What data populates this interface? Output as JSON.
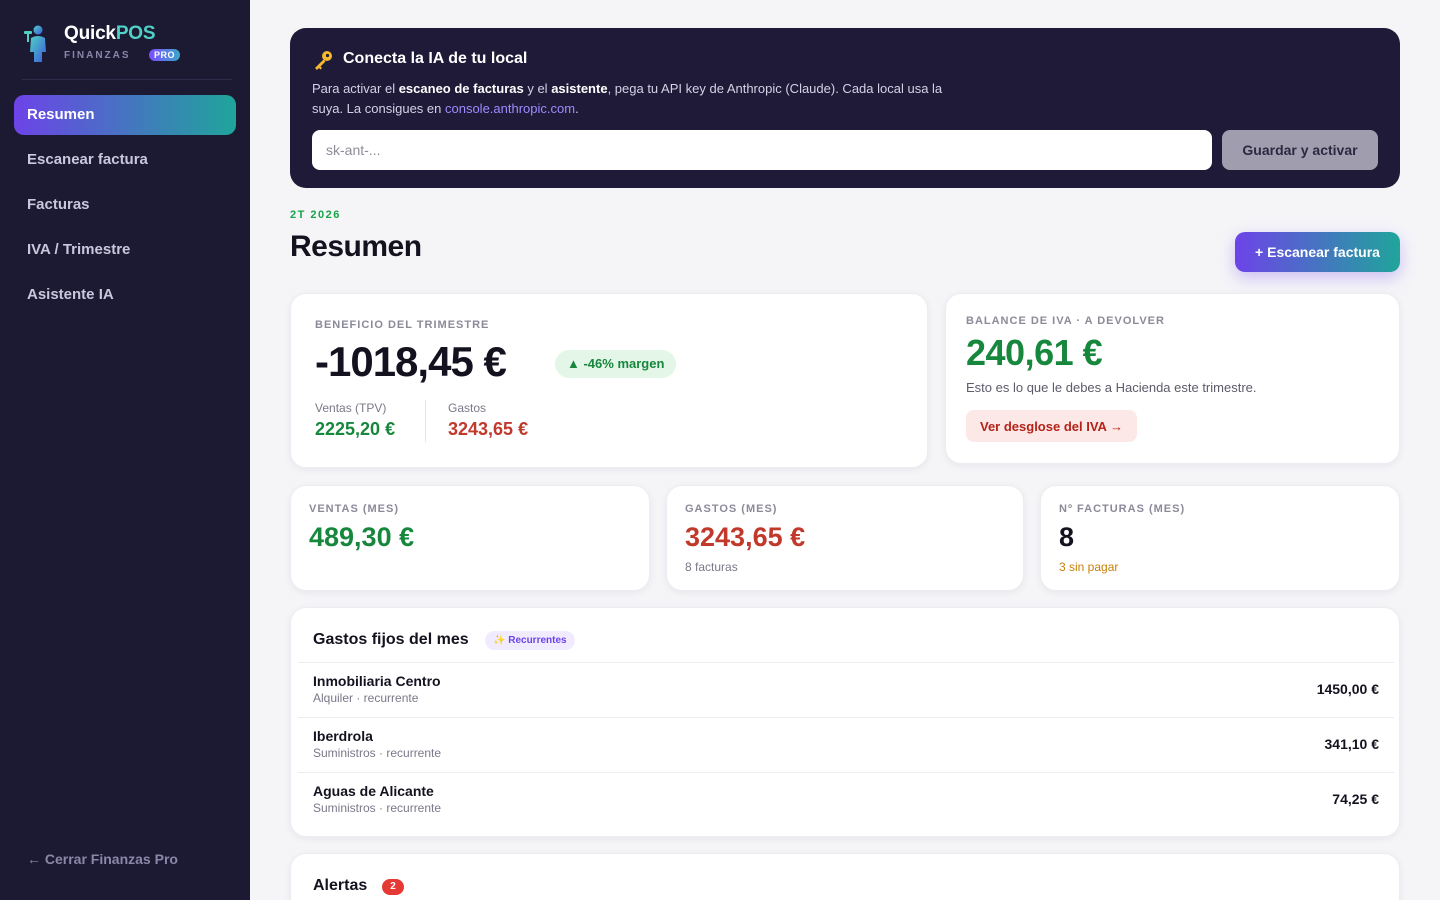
{
  "sidebar": {
    "brand": {
      "name_main": "Quick",
      "name_accent": "POS",
      "subtitle": "FINANZAS",
      "badge": "PRO"
    },
    "items": [
      {
        "label": "Resumen",
        "active": true
      },
      {
        "label": "Escanear factura"
      },
      {
        "label": "Facturas"
      },
      {
        "label": "IVA / Trimestre"
      },
      {
        "label": "Asistente IA"
      }
    ],
    "close_label": "← Cerrar Finanzas Pro"
  },
  "ai_banner": {
    "icon": "key-icon",
    "title": "Conecta la IA de tu local",
    "desc_1": "Para activar el ",
    "desc_b1": "escaneo de facturas",
    "desc_2": " y el ",
    "desc_b2": "asistente",
    "desc_3": ", pega tu API key de Anthropic (Claude). Cada local usa la suya. La consigues en ",
    "desc_link": "console.anthropic.com",
    "desc_4": ".",
    "input_value": "",
    "input_placeholder": "sk-ant-...",
    "save_label": "Guardar y activar"
  },
  "header": {
    "period": "2T 2026",
    "title": "Resumen",
    "scan_label": "+ Escanear factura"
  },
  "profit_card": {
    "label": "BENEFICIO DEL TRIMESTRE",
    "value": "-1018,45 €",
    "margin": "▲ -46% margen",
    "sales_label": "Ventas (TPV)",
    "sales_value": "2225,20 €",
    "expenses_label": "Gastos",
    "expenses_value": "3243,65 €"
  },
  "iva_card": {
    "label": "BALANCE DE IVA · A DEVOLVER",
    "value": "240,61 €",
    "note": "Esto es lo que le debes a Hacienda este trimestre.",
    "button": "Ver desglose del IVA →"
  },
  "mini_cards": [
    {
      "label": "VENTAS (MES)",
      "value": "489,30 €",
      "foot": ""
    },
    {
      "label": "GASTOS (MES)",
      "value": "3243,65 €",
      "foot": "8 facturas"
    },
    {
      "label": "Nº FACTURAS (MES)",
      "value": "8",
      "foot": "3 sin pagar"
    }
  ],
  "fixed_expenses": {
    "title": "Gastos fijos del mes",
    "badge": "✨ Recurrentes",
    "rows": [
      {
        "name": "Inmobiliaria Centro",
        "meta": "Alquiler · recurrente",
        "amount": "1450,00 €"
      },
      {
        "name": "Iberdrola",
        "meta": "Suministros · recurrente",
        "amount": "341,10 €"
      },
      {
        "name": "Aguas de Alicante",
        "meta": "Suministros · recurrente",
        "amount": "74,25 €"
      }
    ]
  },
  "alerts": {
    "title": "Alertas",
    "count": "2"
  },
  "colors": {
    "sidebar_bg": "#1c1a33",
    "accent_gradient_start": "#6d43e8",
    "accent_gradient_end": "#1fa59b",
    "positive": "#17873d",
    "negative": "#c0392b",
    "warning": "#c87f0a"
  }
}
